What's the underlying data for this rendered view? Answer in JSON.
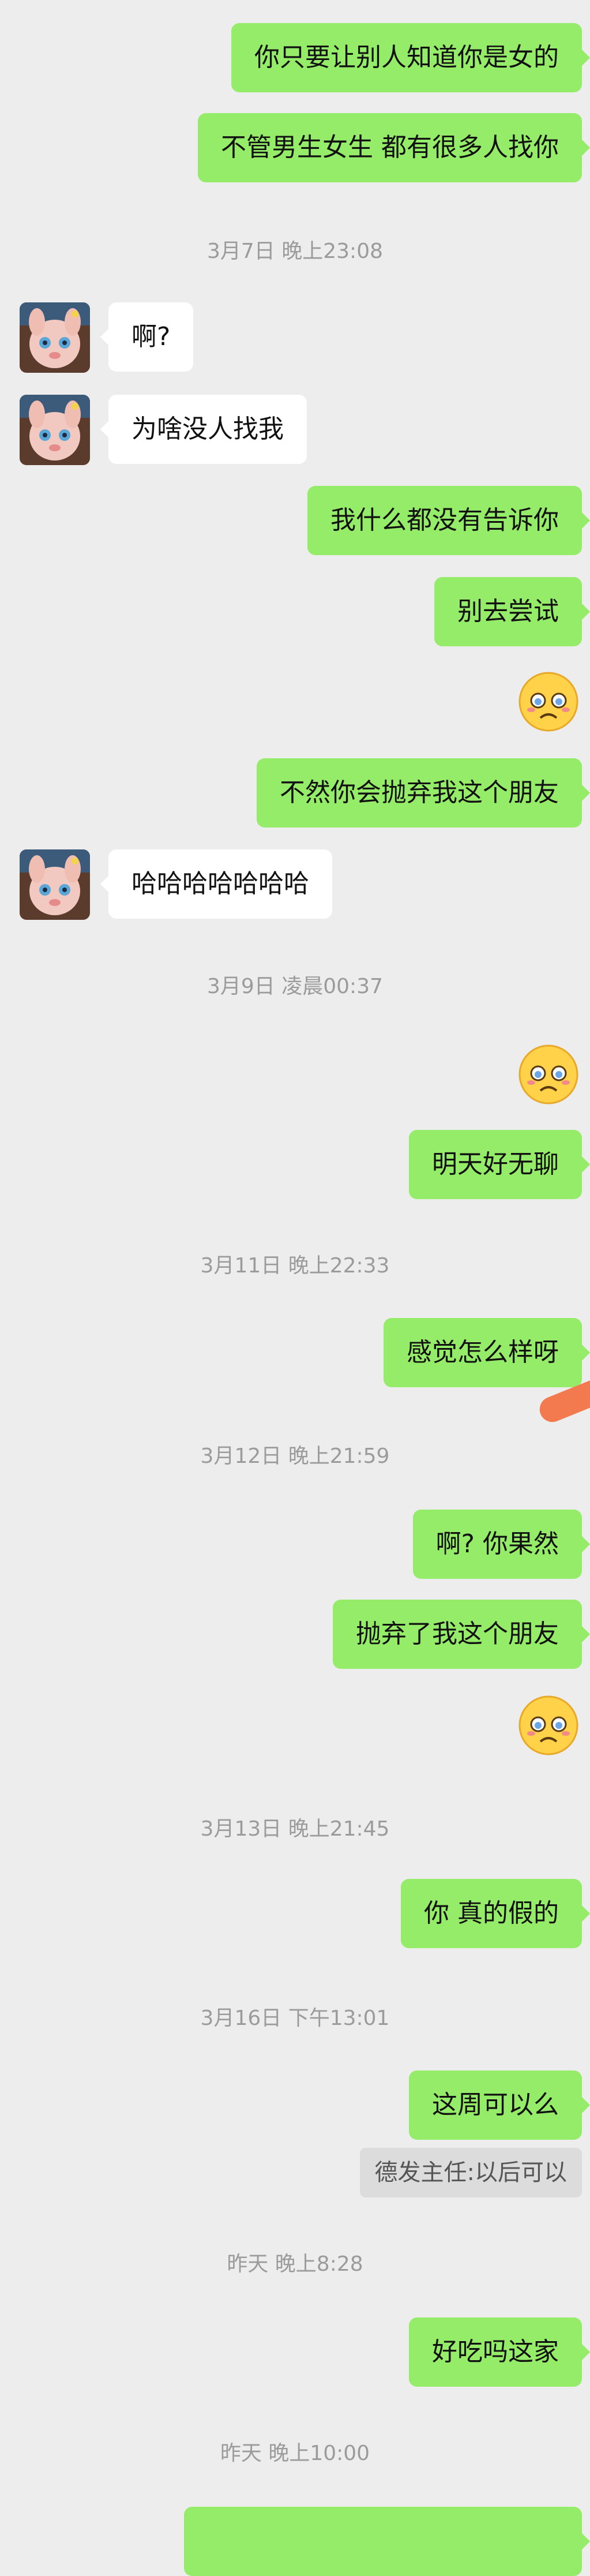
{
  "colors": {
    "background": "#ededed",
    "my_bubble": "#95ec69",
    "their_bubble": "#ffffff",
    "timestamp_text": "#9b9b9b",
    "quote_bg": "#dcdcdc"
  },
  "messages": [
    {
      "text": "你只要让别人知道你是女的"
    },
    {
      "text": "不管男生女生 都有很多人找你"
    },
    {
      "text": "3月7日 晚上23:08"
    },
    {
      "text": "啊?"
    },
    {
      "text": "为啥没人找我"
    },
    {
      "text": "我什么都没有告诉你"
    },
    {
      "text": "别去尝试"
    },
    {
      "icon": "crying-face-emoji"
    },
    {
      "text": "不然你会抛弃我这个朋友"
    },
    {
      "text": "哈哈哈哈哈哈哈"
    },
    {
      "text": "3月9日 凌晨00:37"
    },
    {
      "icon": "crying-face-emoji"
    },
    {
      "text": "明天好无聊"
    },
    {
      "text": "3月11日 晚上22:33"
    },
    {
      "text": "感觉怎么样呀"
    },
    {
      "text": "3月12日 晚上21:59"
    },
    {
      "text": "啊? 你果然"
    },
    {
      "text": "抛弃了我这个朋友"
    },
    {
      "icon": "crying-face-emoji"
    },
    {
      "text": "3月13日 晚上21:45"
    },
    {
      "text": "你 真的假的"
    },
    {
      "text": "3月16日 下午13:01"
    },
    {
      "text": "这周可以么"
    },
    {
      "text": "德发主任:以后可以"
    },
    {
      "text": "昨天 晚上8:28"
    },
    {
      "text": "好吃吗这家"
    },
    {
      "text": "昨天 晚上10:00"
    }
  ]
}
